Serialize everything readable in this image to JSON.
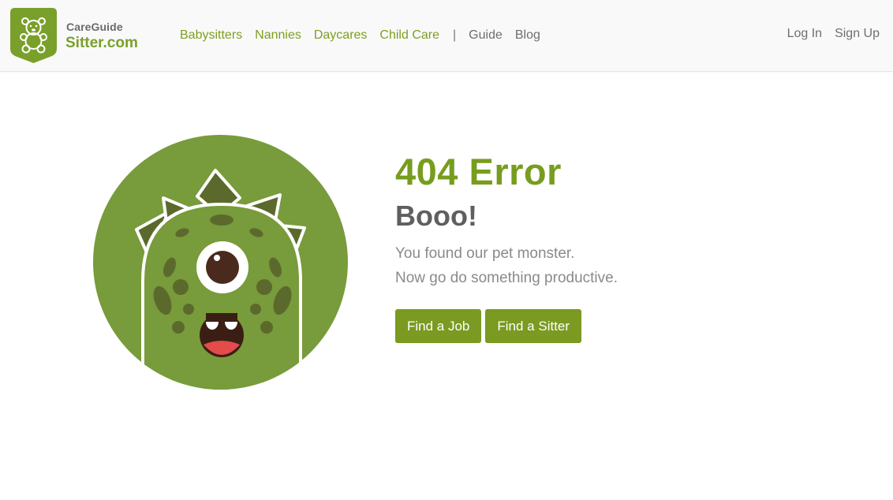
{
  "header": {
    "logo": {
      "top_text": "CareGuide",
      "bottom_text": "Sitter.com"
    },
    "nav": [
      {
        "label": "Babysitters"
      },
      {
        "label": "Nannies"
      },
      {
        "label": "Daycares"
      },
      {
        "label": "Child Care"
      },
      {
        "label": "Guide"
      },
      {
        "label": "Blog"
      }
    ],
    "separator": "|",
    "auth": {
      "login": "Log In",
      "signup": "Sign Up"
    }
  },
  "main": {
    "title": "404 Error",
    "subtitle": "Booo!",
    "lines": [
      "You found our pet monster.",
      "Now go do something productive."
    ],
    "buttons": {
      "find_job": "Find a Job",
      "find_sitter": "Find a Sitter"
    }
  },
  "colors": {
    "brand_green": "#7a9a21",
    "monster_green": "#789b3b",
    "dark_green": "#5b6a2c",
    "text_grey": "#6f6f6f"
  },
  "icons": [
    "teddy-bear-logo-icon",
    "monster-illustration"
  ]
}
